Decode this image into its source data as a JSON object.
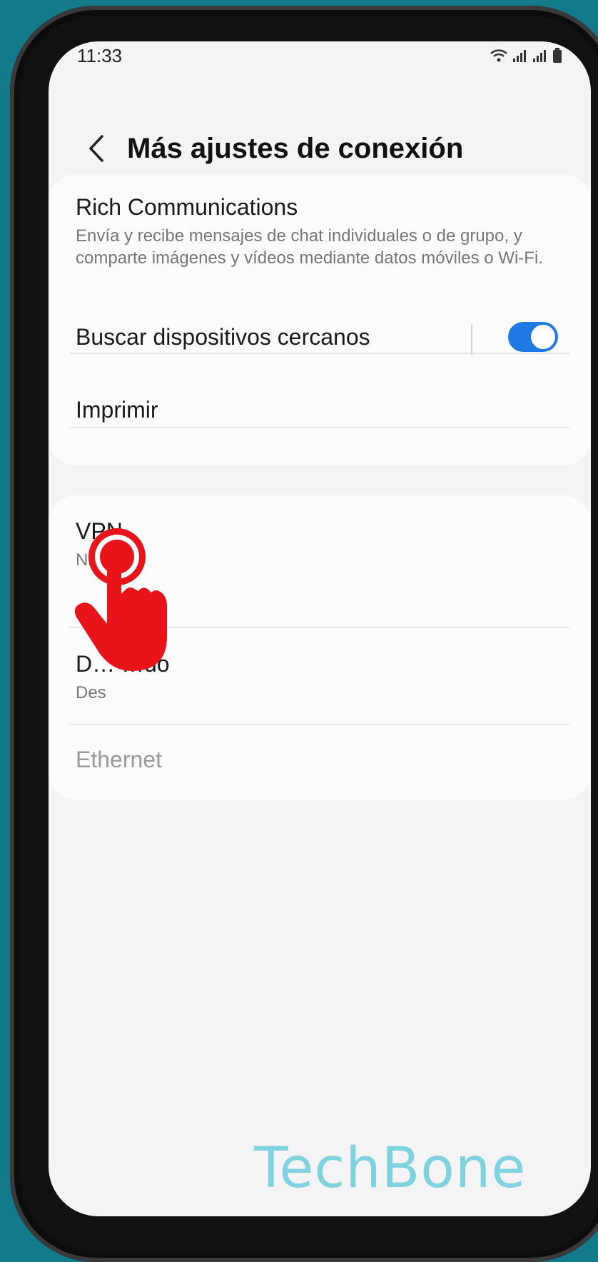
{
  "status_bar": {
    "time": "11:33"
  },
  "header": {
    "title": "Más ajustes de conexión"
  },
  "sections": [
    {
      "items": [
        {
          "title": "Rich Communications",
          "subtitle": "Envía y recibe mensajes de chat individuales o de grupo, y comparte imágenes y vídeos mediante datos móviles o Wi-Fi."
        },
        {
          "title": "Buscar dispositivos cercanos",
          "toggle": true
        },
        {
          "title": "Imprimir"
        }
      ]
    },
    {
      "items": [
        {
          "title": "VPN",
          "subtitle": "Nin"
        },
        {
          "title": "D… …do",
          "subtitle": "Des"
        },
        {
          "title": "Ethernet",
          "disabled": true
        }
      ]
    }
  ],
  "watermark": "TechBone",
  "colors": {
    "accent": "#1f7ae5",
    "tap_hint": "#e8141a",
    "background": "#137a8a"
  }
}
